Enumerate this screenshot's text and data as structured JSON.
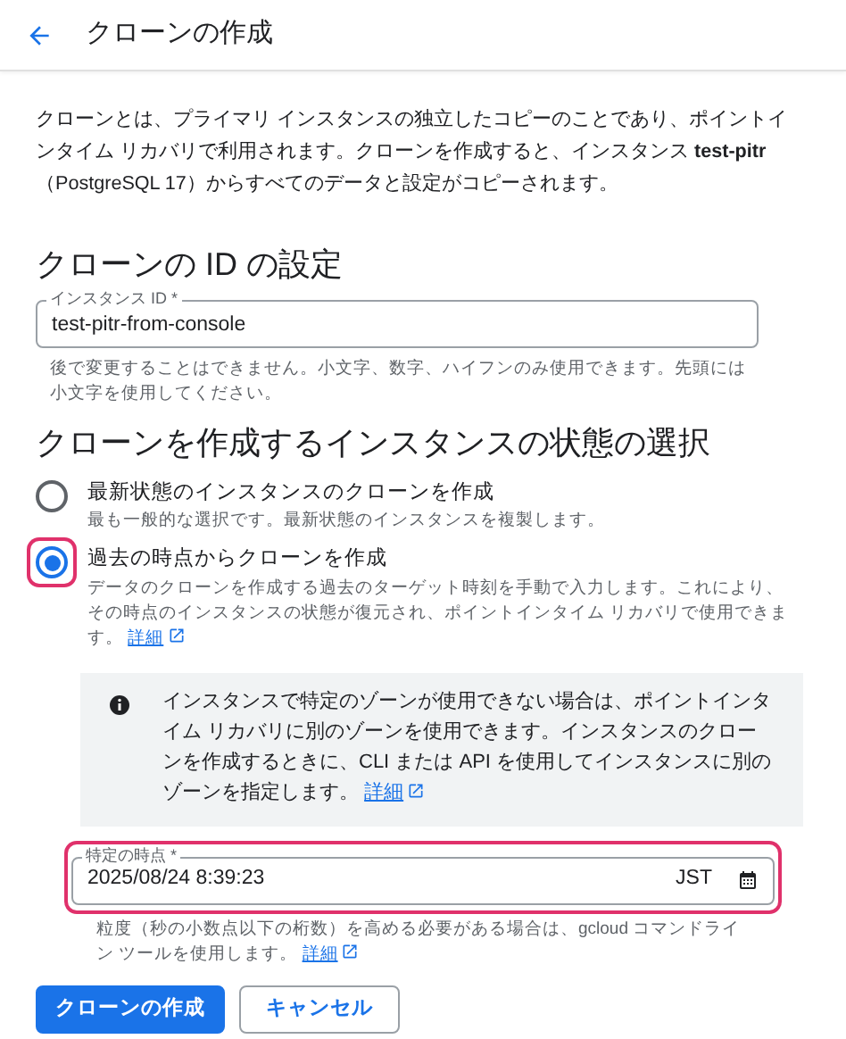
{
  "header": {
    "title": "クローンの作成"
  },
  "intro": "クローンとは、プライマリ インスタンスの独立したコピーのことであり、ポイントインタイム リカバリで利用されます。クローンを作成すると、インスタンス **test-pitr**（PostgreSQL 17）からすべてのデータと設定がコピーされます。",
  "id_section": {
    "heading": "クローンの ID の設定",
    "field": {
      "label": "インスタンス ID *",
      "value": "test-pitr-from-console"
    },
    "help": "後で変更することはできません。小文字、数字、ハイフンのみ使用できます。先頭には小文字を使用してください。"
  },
  "state_section": {
    "heading": "クローンを作成するインスタンスの状態の選択",
    "options": [
      {
        "label": "最新状態のインスタンスのクローンを作成",
        "description": "最も一般的な選択です。最新状態のインスタンスを複製します。",
        "selected": false,
        "highlighted": false
      },
      {
        "label": "過去の時点からクローンを作成",
        "description": "データのクローンを作成する過去のターゲット時刻を手動で入力します。これにより、その時点のインスタンスの状態が復元され、ポイントインタイム リカバリで使用できます。",
        "link": "詳細",
        "selected": true,
        "highlighted": true
      }
    ]
  },
  "info": {
    "text": "インスタンスで特定のゾーンが使用できない場合は、ポイントインタイム リカバリに別のゾーンを使用できます。インスタンスのクローンを作成するときに、CLI または API を使用してインスタンスに別のゾーンを指定します。",
    "link": "詳細"
  },
  "time_field": {
    "label": "特定の時点 *",
    "value": "2025/08/24 8:39:23",
    "suffix": "JST",
    "highlighted": true,
    "help": "粒度（秒の小数点以下の桁数）を高める必要がある場合は、gcloud コマンドライン ツールを使用します。",
    "link": "詳細"
  },
  "buttons": [
    {
      "label": "クローンの作成",
      "kind": "primary"
    },
    {
      "label": "キャンセル",
      "kind": "outline"
    }
  ]
}
